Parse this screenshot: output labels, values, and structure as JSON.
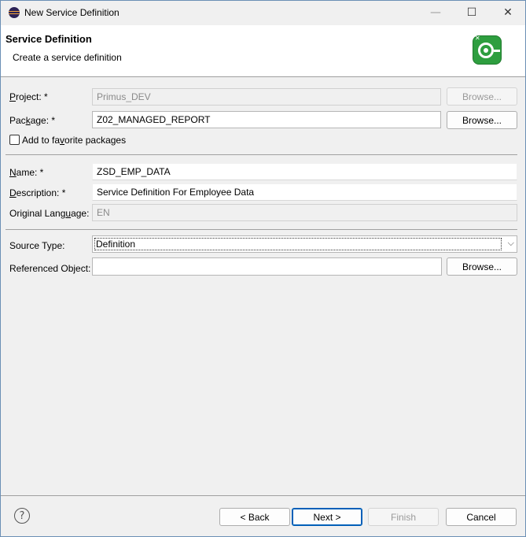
{
  "window": {
    "title": "New Service Definition",
    "controls": {
      "minimize": "—",
      "maximize": "☐",
      "close": "✕"
    }
  },
  "header": {
    "title": "Service Definition",
    "description": "Create a service definition"
  },
  "form": {
    "project": {
      "label_pre": "",
      "label_u": "P",
      "label_post": "roject: *",
      "value": "Primus_DEV",
      "browse": "Browse..."
    },
    "package": {
      "label_pre": "Pac",
      "label_u": "k",
      "label_post": "age: *",
      "value": "Z02_MANAGED_REPORT",
      "browse": "Browse..."
    },
    "favorite": {
      "label_pre": "Add to fa",
      "label_u": "v",
      "label_post": "orite packages"
    },
    "name": {
      "label_pre": "",
      "label_u": "N",
      "label_post": "ame: *",
      "value": "ZSD_EMP_DATA"
    },
    "description": {
      "label_pre": "",
      "label_u": "D",
      "label_post": "escription: *",
      "value": "Service Definition For Employee Data"
    },
    "original_language": {
      "label_pre": "Original Lang",
      "label_u": "u",
      "label_post": "age:",
      "value": "EN"
    },
    "source_type": {
      "label": "Source Type:",
      "value": "Definition"
    },
    "referenced_object": {
      "label": "Referenced Object:",
      "value": "",
      "browse": "Browse..."
    }
  },
  "footer": {
    "help": "?",
    "back": "< Back",
    "next": "Next >",
    "finish": "Finish",
    "cancel": "Cancel"
  },
  "colors": {
    "accent": "#005fb8",
    "brand_icon": "#2e9e3f"
  }
}
